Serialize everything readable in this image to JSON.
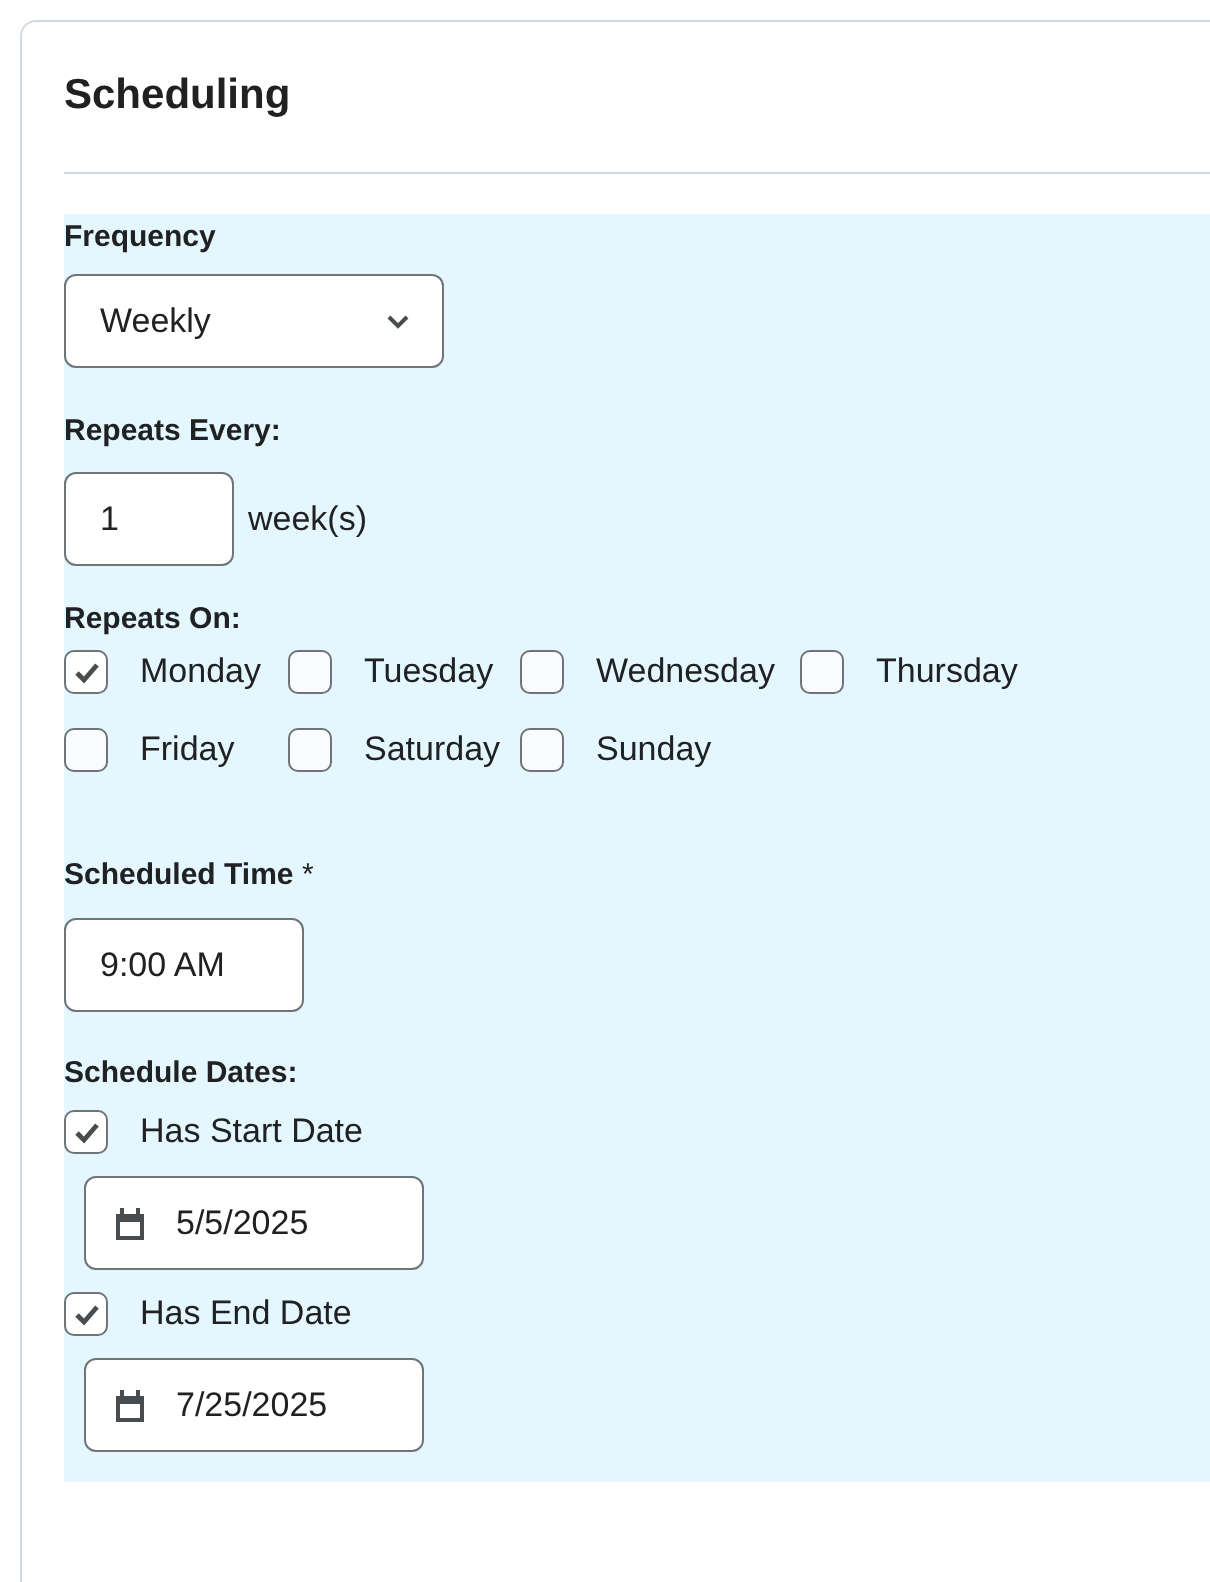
{
  "title": "Scheduling",
  "frequency": {
    "label": "Frequency",
    "value": "Weekly"
  },
  "repeats_every": {
    "label": "Repeats Every:",
    "value": "1",
    "unit": "week(s)"
  },
  "repeats_on": {
    "label": "Repeats On:",
    "days": [
      {
        "label": "Monday",
        "checked": true
      },
      {
        "label": "Tuesday",
        "checked": false
      },
      {
        "label": "Wednesday",
        "checked": false
      },
      {
        "label": "Thursday",
        "checked": false
      },
      {
        "label": "Friday",
        "checked": false
      },
      {
        "label": "Saturday",
        "checked": false
      },
      {
        "label": "Sunday",
        "checked": false
      }
    ]
  },
  "scheduled_time": {
    "label": "Scheduled Time",
    "required_mark": "*",
    "value": "9:00 AM"
  },
  "schedule_dates": {
    "label": "Schedule Dates:",
    "items": [
      {
        "label": "Has Start Date",
        "checked": true,
        "date": "5/5/2025"
      },
      {
        "label": "Has End Date",
        "checked": true,
        "date": "7/25/2025"
      }
    ]
  }
}
